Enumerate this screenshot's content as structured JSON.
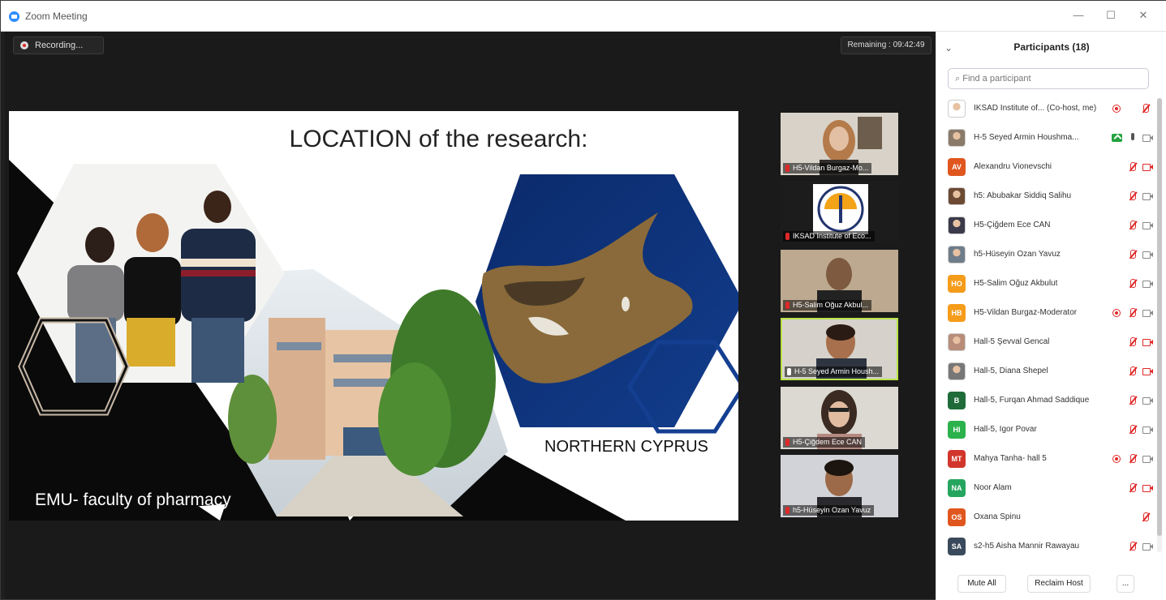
{
  "window": {
    "title": "Zoom Meeting",
    "minimize": "—",
    "maximize": "☐",
    "close": "✕"
  },
  "stage": {
    "recording_label": "Recording...",
    "remaining_label": "Remaining : 09:42:49",
    "slide": {
      "title": "LOCATION of the research:",
      "caption_left": "EMU- faculty of pharmacy",
      "caption_right": "NORTHERN CYPRUS"
    },
    "videos": [
      {
        "label": "H5-Vildan Burgaz-Mo..."
      },
      {
        "label": "IKSAD Institute of Eco..."
      },
      {
        "label": "H5-Salim Oğuz Akbul..."
      },
      {
        "label": "H-5 Seyed Armin Housh..."
      },
      {
        "label": "H5-Çiğdem Ece CAN"
      },
      {
        "label": "h5-Hüseyin Ozan Yavuz"
      }
    ]
  },
  "panel": {
    "title": "Participants (18)",
    "search_placeholder": "Find a participant",
    "participants": [
      {
        "name": "IKSAD Institute of...  (Co-host, me)",
        "initials": "",
        "color": "#ffffff",
        "mic": "muted",
        "cam": "none",
        "rec": true
      },
      {
        "name": "H-5 Seyed Armin Houshma...",
        "initials": "",
        "color": "#8a7a6a",
        "mic": "on",
        "cam": "on",
        "share": true
      },
      {
        "name": "Alexandru Vionevschi",
        "initials": "AV",
        "color": "#e0561f",
        "mic": "muted",
        "cam": "off"
      },
      {
        "name": "h5: Abubakar Siddiq Salihu",
        "initials": "",
        "color": "#6d4a33",
        "mic": "muted",
        "cam": "on"
      },
      {
        "name": "H5-Çiğdem Ece CAN",
        "initials": "",
        "color": "#3a3a4a",
        "mic": "muted",
        "cam": "on"
      },
      {
        "name": "h5-Hüseyin Ozan Yavuz",
        "initials": "",
        "color": "#6f7d8a",
        "mic": "muted",
        "cam": "on"
      },
      {
        "name": "H5-Salim Oğuz Akbulut",
        "initials": "HO",
        "color": "#f59c1a",
        "mic": "muted",
        "cam": "on"
      },
      {
        "name": "H5-Vildan Burgaz-Moderator",
        "initials": "HB",
        "color": "#f59c1a",
        "mic": "muted",
        "cam": "on",
        "rec": true
      },
      {
        "name": "Hall-5 Şevval Gencal",
        "initials": "",
        "color": "#b88d7a",
        "mic": "muted",
        "cam": "off"
      },
      {
        "name": "Hall-5, Diana Shepel",
        "initials": "",
        "color": "#777777",
        "mic": "muted",
        "cam": "off"
      },
      {
        "name": "Hall-5, Furqan Ahmad Saddique",
        "initials": "B",
        "color": "#1f6b3a",
        "mic": "muted",
        "cam": "on"
      },
      {
        "name": "Hall-5, Igor Povar",
        "initials": "HI",
        "color": "#2bb24c",
        "mic": "muted",
        "cam": "on"
      },
      {
        "name": "Mahya Tanha- hall 5",
        "initials": "MT",
        "color": "#d1352b",
        "mic": "muted",
        "cam": "on",
        "rec": true
      },
      {
        "name": "Noor Alam",
        "initials": "NA",
        "color": "#25a55f",
        "mic": "muted",
        "cam": "off"
      },
      {
        "name": "Oxana Spinu",
        "initials": "OS",
        "color": "#e0561f",
        "mic": "muted",
        "cam": "none"
      },
      {
        "name": "s2-h5 Aisha Mannir Rawayau",
        "initials": "SA",
        "color": "#3a4a5c",
        "mic": "muted",
        "cam": "on"
      }
    ],
    "mute_all": "Mute All",
    "reclaim_host": "Reclaim Host",
    "more": "..."
  }
}
